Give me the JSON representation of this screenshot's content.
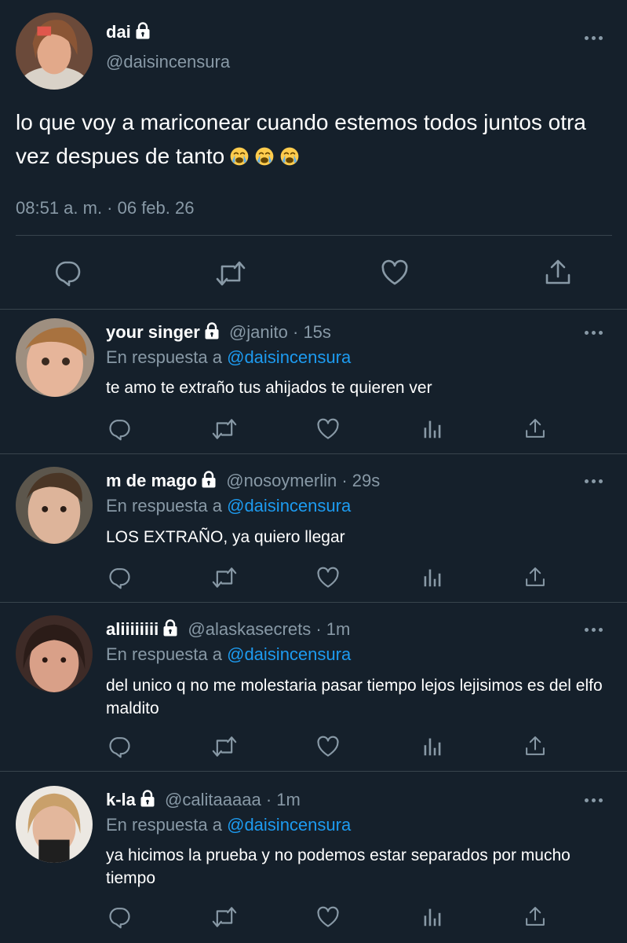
{
  "main_tweet": {
    "name": "dai",
    "handle": "@daisincensura",
    "text": "lo que voy a mariconear cuando estemos todos juntos otra vez despues de tanto",
    "emojis": [
      "loudly-crying-face",
      "loudly-crying-face",
      "loudly-crying-face"
    ],
    "timestamp": "08:51 a. m. · 06 feb. 26"
  },
  "replies": [
    {
      "name": "your singer",
      "handle": "@janito",
      "time": "· 15s",
      "reply_prefix": "En respuesta a",
      "reply_to": "@daisincensura",
      "text": "te amo te extraño tus ahijados te quieren ver"
    },
    {
      "name": "m de mago",
      "handle": "@nosoymerlin",
      "time": "· 29s",
      "reply_prefix": "En respuesta a",
      "reply_to": "@daisincensura",
      "text": "LOS EXTRAÑO, ya quiero llegar"
    },
    {
      "name": "aliiiiiiii",
      "handle": "@alaskasecrets",
      "time": "· 1m",
      "reply_prefix": "En respuesta a",
      "reply_to": "@daisincensura",
      "text": "del unico q no me molestaria pasar tiempo lejos lejisimos es del elfo maldito"
    },
    {
      "name": "k-la",
      "handle": "@calitaaaaa",
      "time": "· 1m",
      "reply_prefix": "En respuesta a",
      "reply_to": "@daisincensura",
      "text": "ya hicimos la prueba y no podemos estar separados por mucho tiempo"
    }
  ],
  "icons": [
    "lock-icon",
    "more-icon",
    "reply-icon",
    "retweet-icon",
    "like-icon",
    "share-icon",
    "analytics-icon"
  ],
  "colors": {
    "background": "#15202b",
    "muted": "#8899a6",
    "link": "#1d9bf0",
    "divider": "#38444d"
  }
}
